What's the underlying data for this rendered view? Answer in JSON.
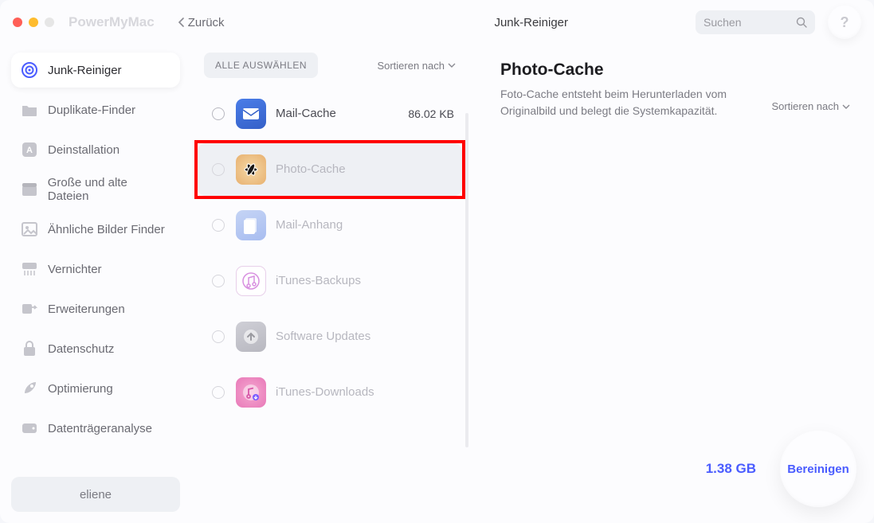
{
  "app_name": "PowerMyMac",
  "back_label": "Zurück",
  "header_title": "Junk-Reiniger",
  "search_placeholder": "Suchen",
  "help_symbol": "?",
  "sidebar": [
    {
      "id": "junk",
      "label": "Junk-Reiniger",
      "active": true
    },
    {
      "id": "dup",
      "label": "Duplikate-Finder"
    },
    {
      "id": "uninst",
      "label": "Deinstallation"
    },
    {
      "id": "large",
      "label": "Große und alte Dateien"
    },
    {
      "id": "similar",
      "label": "Ähnliche Bilder Finder"
    },
    {
      "id": "shred",
      "label": "Vernichter"
    },
    {
      "id": "ext",
      "label": "Erweiterungen"
    },
    {
      "id": "priv",
      "label": "Datenschutz"
    },
    {
      "id": "opt",
      "label": "Optimierung"
    },
    {
      "id": "disk",
      "label": "Datenträgeranalyse"
    }
  ],
  "user": "eliene",
  "select_all": "ALLE AUSWÄHLEN",
  "sort_label": "Sortieren nach",
  "items": [
    {
      "label": "Mail-Cache",
      "size": "86.02 KB",
      "icon": "mail"
    },
    {
      "label": "Photo-Cache",
      "icon": "photo",
      "selected": true,
      "highlight": true
    },
    {
      "label": "Mail-Anhang",
      "icon": "attach",
      "dim": true
    },
    {
      "label": "iTunes-Backups",
      "icon": "itunes",
      "dim": true
    },
    {
      "label": "Software Updates",
      "icon": "upd",
      "dim": true
    },
    {
      "label": "iTunes-Downloads",
      "icon": "dl",
      "dim": true
    }
  ],
  "detail": {
    "title": "Photo-Cache",
    "desc": "Foto-Cache entsteht beim Herunterladen vom Originalbild und belegt die Systemkapazität."
  },
  "total_size": "1.38 GB",
  "clean_label": "Bereinigen"
}
